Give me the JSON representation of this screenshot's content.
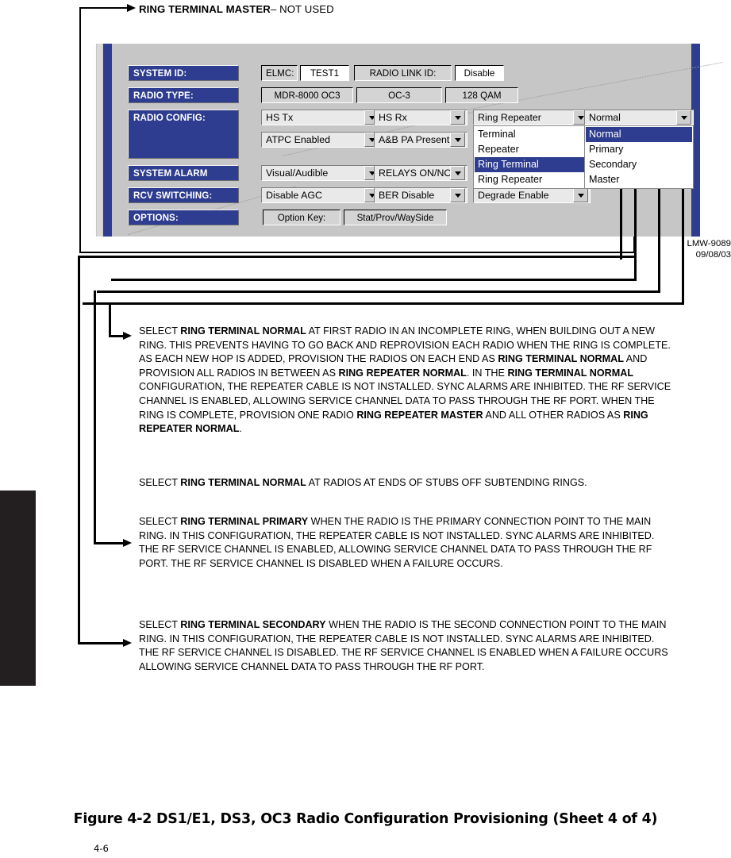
{
  "header_callout": {
    "bold_text": "RING TERMINAL MASTER",
    "regular_text": " – NOT USED"
  },
  "dialog": {
    "rows": [
      {
        "label": "SYSTEM ID:",
        "fields": [
          {
            "name": "elmc-label",
            "value": "ELMC:"
          },
          {
            "name": "elmc-value",
            "value": "TEST1"
          },
          {
            "name": "radio-link-id-label",
            "value": "RADIO LINK ID:"
          },
          {
            "name": "radio-link-id-value",
            "value": "Disable"
          }
        ]
      },
      {
        "label": "RADIO TYPE:",
        "fields": [
          {
            "name": "radio-model",
            "value": "MDR-8000 OC3"
          },
          {
            "name": "radio-rate",
            "value": "OC-3"
          },
          {
            "name": "radio-modulation",
            "value": "128 QAM"
          }
        ]
      },
      {
        "label": "RADIO CONFIG:",
        "combos_row1": [
          "HS Tx",
          "HS Rx",
          "Ring Repeater",
          "Normal"
        ],
        "combos_row2": [
          "ATPC Enabled",
          "A&B PA Present"
        ]
      },
      {
        "label": "SYSTEM ALARM",
        "combos": [
          "Visual/Audible",
          "RELAYS ON/NO"
        ]
      },
      {
        "label": "RCV SWITCHING:",
        "combos": [
          "Disable AGC",
          "BER Disable",
          "Degrade Enable"
        ]
      },
      {
        "label": "OPTIONS:",
        "fields": [
          {
            "name": "option-key-label",
            "value": "Option Key:"
          },
          {
            "name": "option-key-value",
            "value": "Stat/Prov/WaySide"
          }
        ]
      }
    ],
    "config_dropdown": {
      "items": [
        "Terminal",
        "Repeater",
        "Ring Terminal",
        "Ring Repeater"
      ],
      "selected": "Ring Terminal"
    },
    "mode_dropdown": {
      "items": [
        "Normal",
        "Primary",
        "Secondary",
        "Master"
      ],
      "selected": "Normal"
    }
  },
  "doc_id": {
    "number": "LMW-9089",
    "date": "09/08/03"
  },
  "paragraphs": {
    "normal": [
      {
        "t": "SELECT ",
        "b": false
      },
      {
        "t": "RING TERMINAL NORMAL",
        "b": true
      },
      {
        "t": " AT FIRST RADIO IN AN INCOMPLETE RING, WHEN BUILDING OUT A NEW RING. THIS PREVENTS HAVING TO GO BACK AND REPROVISION EACH RADIO WHEN THE RING IS COMPLETE. AS EACH NEW HOP IS ADDED, PROVISION THE RADIOS ON EACH END AS ",
        "b": false
      },
      {
        "t": "RING TERMINAL NORMAL",
        "b": true
      },
      {
        "t": " AND PROVISION ALL RADIOS IN BETWEEN AS ",
        "b": false
      },
      {
        "t": "RING REPEATER NORMAL",
        "b": true
      },
      {
        "t": ". IN THE ",
        "b": false
      },
      {
        "t": "RING TERMINAL NORMAL",
        "b": true
      },
      {
        "t": " CONFIGURATION, THE REPEATER CABLE IS NOT INSTALLED. SYNC ALARMS ARE INHIBITED. THE RF SERVICE CHANNEL IS ENABLED, ALLOWING SERVICE CHANNEL DATA TO PASS THROUGH THE RF PORT. WHEN THE RING IS COMPLETE, PROVISION ONE RADIO ",
        "b": false
      },
      {
        "t": "RING REPEATER MASTER",
        "b": true
      },
      {
        "t": " AND ALL OTHER RADIOS AS ",
        "b": false
      },
      {
        "t": "RING REPEATER NORMAL",
        "b": true
      },
      {
        "t": ".",
        "b": false
      }
    ],
    "stubs": [
      {
        "t": "SELECT ",
        "b": false
      },
      {
        "t": "RING TERMINAL NORMAL",
        "b": true
      },
      {
        "t": " AT RADIOS AT ENDS OF STUBS OFF SUBTENDING RINGS.",
        "b": false
      }
    ],
    "primary": [
      {
        "t": "SELECT ",
        "b": false
      },
      {
        "t": "RING TERMINAL PRIMARY",
        "b": true
      },
      {
        "t": " WHEN THE RADIO IS THE PRIMARY CONNECTION POINT TO THE MAIN RING. IN THIS CONFIGURATION, THE REPEATER CABLE IS NOT INSTALLED. SYNC ALARMS ARE INHIBITED. THE RF SERVICE CHANNEL IS ENABLED, ALLOWING SERVICE CHANNEL DATA TO PASS THROUGH THE RF PORT. THE RF SERVICE CHANNEL IS DISABLED WHEN A FAILURE OCCURS.",
        "b": false
      }
    ],
    "secondary": [
      {
        "t": "SELECT ",
        "b": false
      },
      {
        "t": "RING TERMINAL SECONDARY",
        "b": true
      },
      {
        "t": " WHEN THE RADIO IS THE SECOND CONNECTION POINT TO THE MAIN RING. IN THIS CONFIGURATION, THE REPEATER CABLE IS NOT INSTALLED. SYNC ALARMS ARE INHIBITED. THE RF SERVICE CHANNEL IS DISABLED. THE RF SERVICE CHANNEL IS ENABLED WHEN A FAILURE OCCURS ALLOWING SERVICE CHANNEL DATA TO PASS THROUGH THE RF PORT.",
        "b": false
      }
    ]
  },
  "figure_caption": "Figure 4-2  DS1/E1, DS3, OC3 Radio Configuration Provisioning (Sheet 4 of 4)",
  "page_number": "4-6"
}
